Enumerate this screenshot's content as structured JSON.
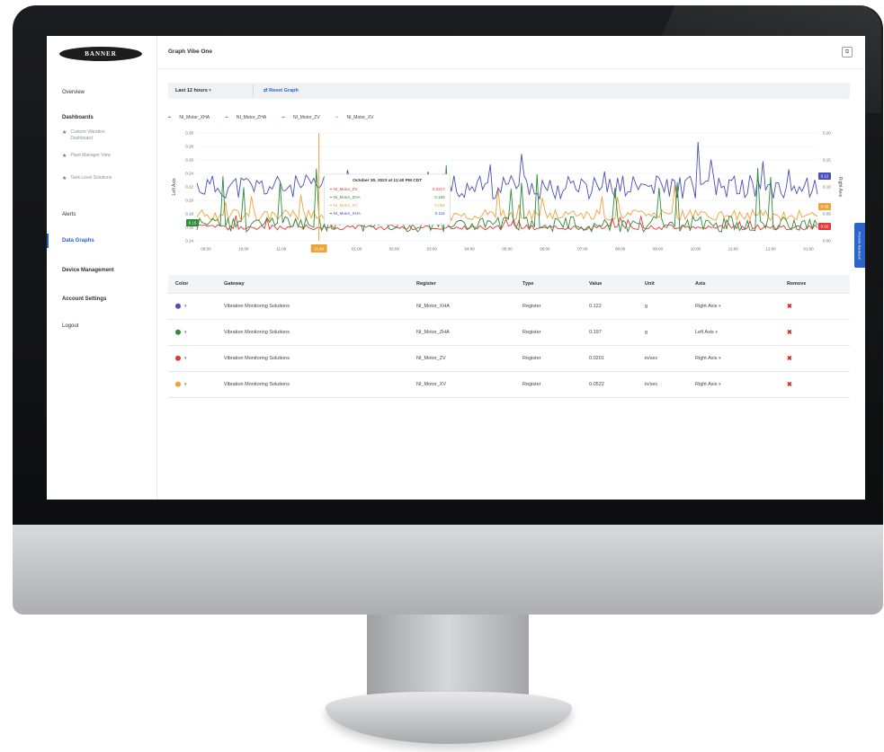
{
  "app": {
    "logo_text": "BANNER",
    "page_title": "Graph Vibe One",
    "corner_icon": "popout-icon"
  },
  "sidebar": {
    "items": [
      {
        "label": "Overview"
      },
      {
        "label": "Dashboards"
      },
      {
        "label": "Alerts"
      },
      {
        "label": "Data Graphs"
      },
      {
        "label": "Device Management"
      },
      {
        "label": "Account Settings"
      },
      {
        "label": "Logout"
      }
    ],
    "dashboards": [
      {
        "label": "Custom Vibration Dashboard"
      },
      {
        "label": "Plant Manager View"
      },
      {
        "label": "Tank Level Solutions"
      }
    ]
  },
  "toolbar": {
    "range_label": "Last 12 hours",
    "reset_label": "Reset Graph",
    "caret": "▾",
    "reset_icon": "⇄"
  },
  "feedback_tab": "Provide feedback",
  "colors": {
    "blue": "#4b4fb8",
    "green": "#2e8b3a",
    "red": "#e03a3a",
    "orange": "#f0a23a",
    "accent": "#2a63c9"
  },
  "chart_data": {
    "type": "line",
    "series": [
      {
        "name": "NI_Motor_XHA",
        "color": "#4b4fb8",
        "axis": "right"
      },
      {
        "name": "NI_Motor_ZHA",
        "color": "#2e8b3a",
        "axis": "left"
      },
      {
        "name": "NI_Motor_ZV",
        "color": "#e03a3a",
        "axis": "right"
      },
      {
        "name": "NI_Motor_XV",
        "color": "#f0a23a",
        "axis": "right"
      }
    ],
    "x_ticks": [
      "09:00",
      "10:00",
      "11:00",
      "11:40",
      "01:00",
      "02:00",
      "03:00",
      "04:00",
      "05:00",
      "06:00",
      "07:00",
      "08:00",
      "09:00",
      "10:00",
      "11:00",
      "12:00",
      "01:00"
    ],
    "left_axis": {
      "label": "Left Axis",
      "ticks": [
        "0.14",
        "0.16",
        "0.18",
        "0.20",
        "0.22",
        "0.24",
        "0.26",
        "0.28",
        "0.30"
      ],
      "ylim": [
        0.14,
        0.3
      ]
    },
    "right_axis": {
      "label": "Right Axis",
      "ticks": [
        "0.00",
        "0.05",
        "0.10",
        "0.15",
        "0.20"
      ],
      "ylim": [
        0.0,
        0.2
      ]
    },
    "badges": {
      "blue": "0.12",
      "green": "0.15",
      "orange": "0.06",
      "red": "0.02"
    },
    "tooltip": {
      "title": "October 30, 2023 at 11:40 PM CDT",
      "rows": [
        {
          "name": "NI_Motor_ZV",
          "value": "0.0217"
        },
        {
          "name": "NI_Motor_ZHA",
          "value": "0.158"
        },
        {
          "name": "NI_Motor_XV",
          "value": "0.054"
        },
        {
          "name": "NI_Motor_XHA",
          "value": "0.116"
        }
      ]
    }
  },
  "table": {
    "headers": [
      "Color",
      "Gateway",
      "Register",
      "Type",
      "Value",
      "Unit",
      "Axis",
      "Remove"
    ],
    "rows": [
      {
        "color": "#4b4fb8",
        "gateway": "Vibration Monitoring Solutions",
        "register": "NI_Motor_XHA",
        "type": "Register",
        "value": "0.122",
        "unit": "g",
        "axis": "Right Axis",
        "remove": "✖"
      },
      {
        "color": "#2e8b3a",
        "gateway": "Vibration Monitoring Solutions",
        "register": "NI_Motor_ZHA",
        "type": "Register",
        "value": "0.197",
        "unit": "g",
        "axis": "Left Axis",
        "remove": "✖"
      },
      {
        "color": "#e03a3a",
        "gateway": "Vibration Monitoring Solutions",
        "register": "NI_Motor_ZV",
        "type": "Register",
        "value": "0.0201",
        "unit": "in/sec",
        "axis": "Right Axis",
        "remove": "✖"
      },
      {
        "color": "#f0a23a",
        "gateway": "Vibration Monitoring Solutions",
        "register": "NI_Motor_XV",
        "type": "Register",
        "value": "0.0522",
        "unit": "in/sec",
        "axis": "Right Axis",
        "remove": "✖"
      }
    ]
  }
}
